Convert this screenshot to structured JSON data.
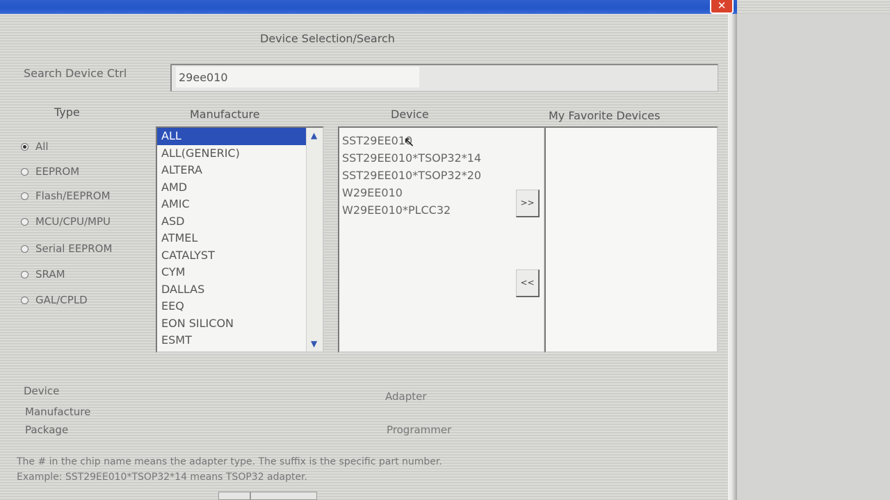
{
  "window": {
    "close_glyph": "✕"
  },
  "dialog": {
    "title": "Device Selection/Search",
    "search_label": "Search Device Ctrl",
    "search_value": "29ee010",
    "headers": {
      "type": "Type",
      "manufacture": "Manufacture",
      "device": "Device",
      "favorites": "My Favorite Devices"
    },
    "types": [
      {
        "label": "All",
        "selected": true
      },
      {
        "label": "EEPROM",
        "selected": false
      },
      {
        "label": "Flash/EEPROM",
        "selected": false
      },
      {
        "label": "MCU/CPU/MPU",
        "selected": false
      },
      {
        "label": "Serial EEPROM",
        "selected": false
      },
      {
        "label": "SRAM",
        "selected": false
      },
      {
        "label": "GAL/CPLD",
        "selected": false
      }
    ],
    "manufacturers": [
      "ALL",
      "ALL(GENERIC)",
      "ALTERA",
      "AMD",
      "AMIC",
      "ASD",
      "ATMEL",
      "CATALYST",
      "CYM",
      "DALLAS",
      "EEQ",
      "EON SILICON",
      "ESMT"
    ],
    "manufacturer_selected": "ALL",
    "devices": [
      "SST29EE010",
      "SST29EE010*TSOP32*14",
      "SST29EE010*TSOP32*20",
      "W29EE010",
      "W29EE010*PLCC32"
    ],
    "add_button": ">>",
    "remove_button": "<<",
    "info_labels": {
      "device": "Device",
      "manufacture": "Manufacture",
      "package": "Package"
    },
    "adapter_label": "Adapter",
    "programmer_label": "Programmer",
    "note_line1": "The # in the chip name means the adapter type. The suffix is the specific part number.",
    "note_line2": "Example: SST29EE010*TSOP32*14 means TSOP32 adapter."
  },
  "colors": {
    "titlebar": "#2456c8",
    "selection": "#2b50b8",
    "close": "#d9432c"
  }
}
